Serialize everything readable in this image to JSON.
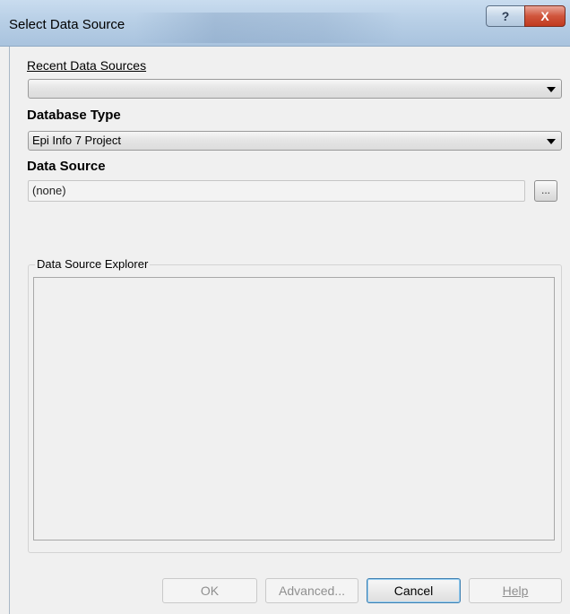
{
  "window": {
    "title": "Select Data Source",
    "help_glyph": "?",
    "close_glyph": "X"
  },
  "recent_sources": {
    "label": "Recent Data Sources",
    "value": ""
  },
  "database_type": {
    "label": "Database Type",
    "value": "Epi Info 7 Project"
  },
  "data_source": {
    "label": "Data Source",
    "value": "(none)",
    "browse_label": "..."
  },
  "explorer": {
    "label": "Data Source Explorer"
  },
  "buttons": {
    "ok": "OK",
    "advanced": "Advanced...",
    "cancel": "Cancel",
    "help": "Help"
  }
}
